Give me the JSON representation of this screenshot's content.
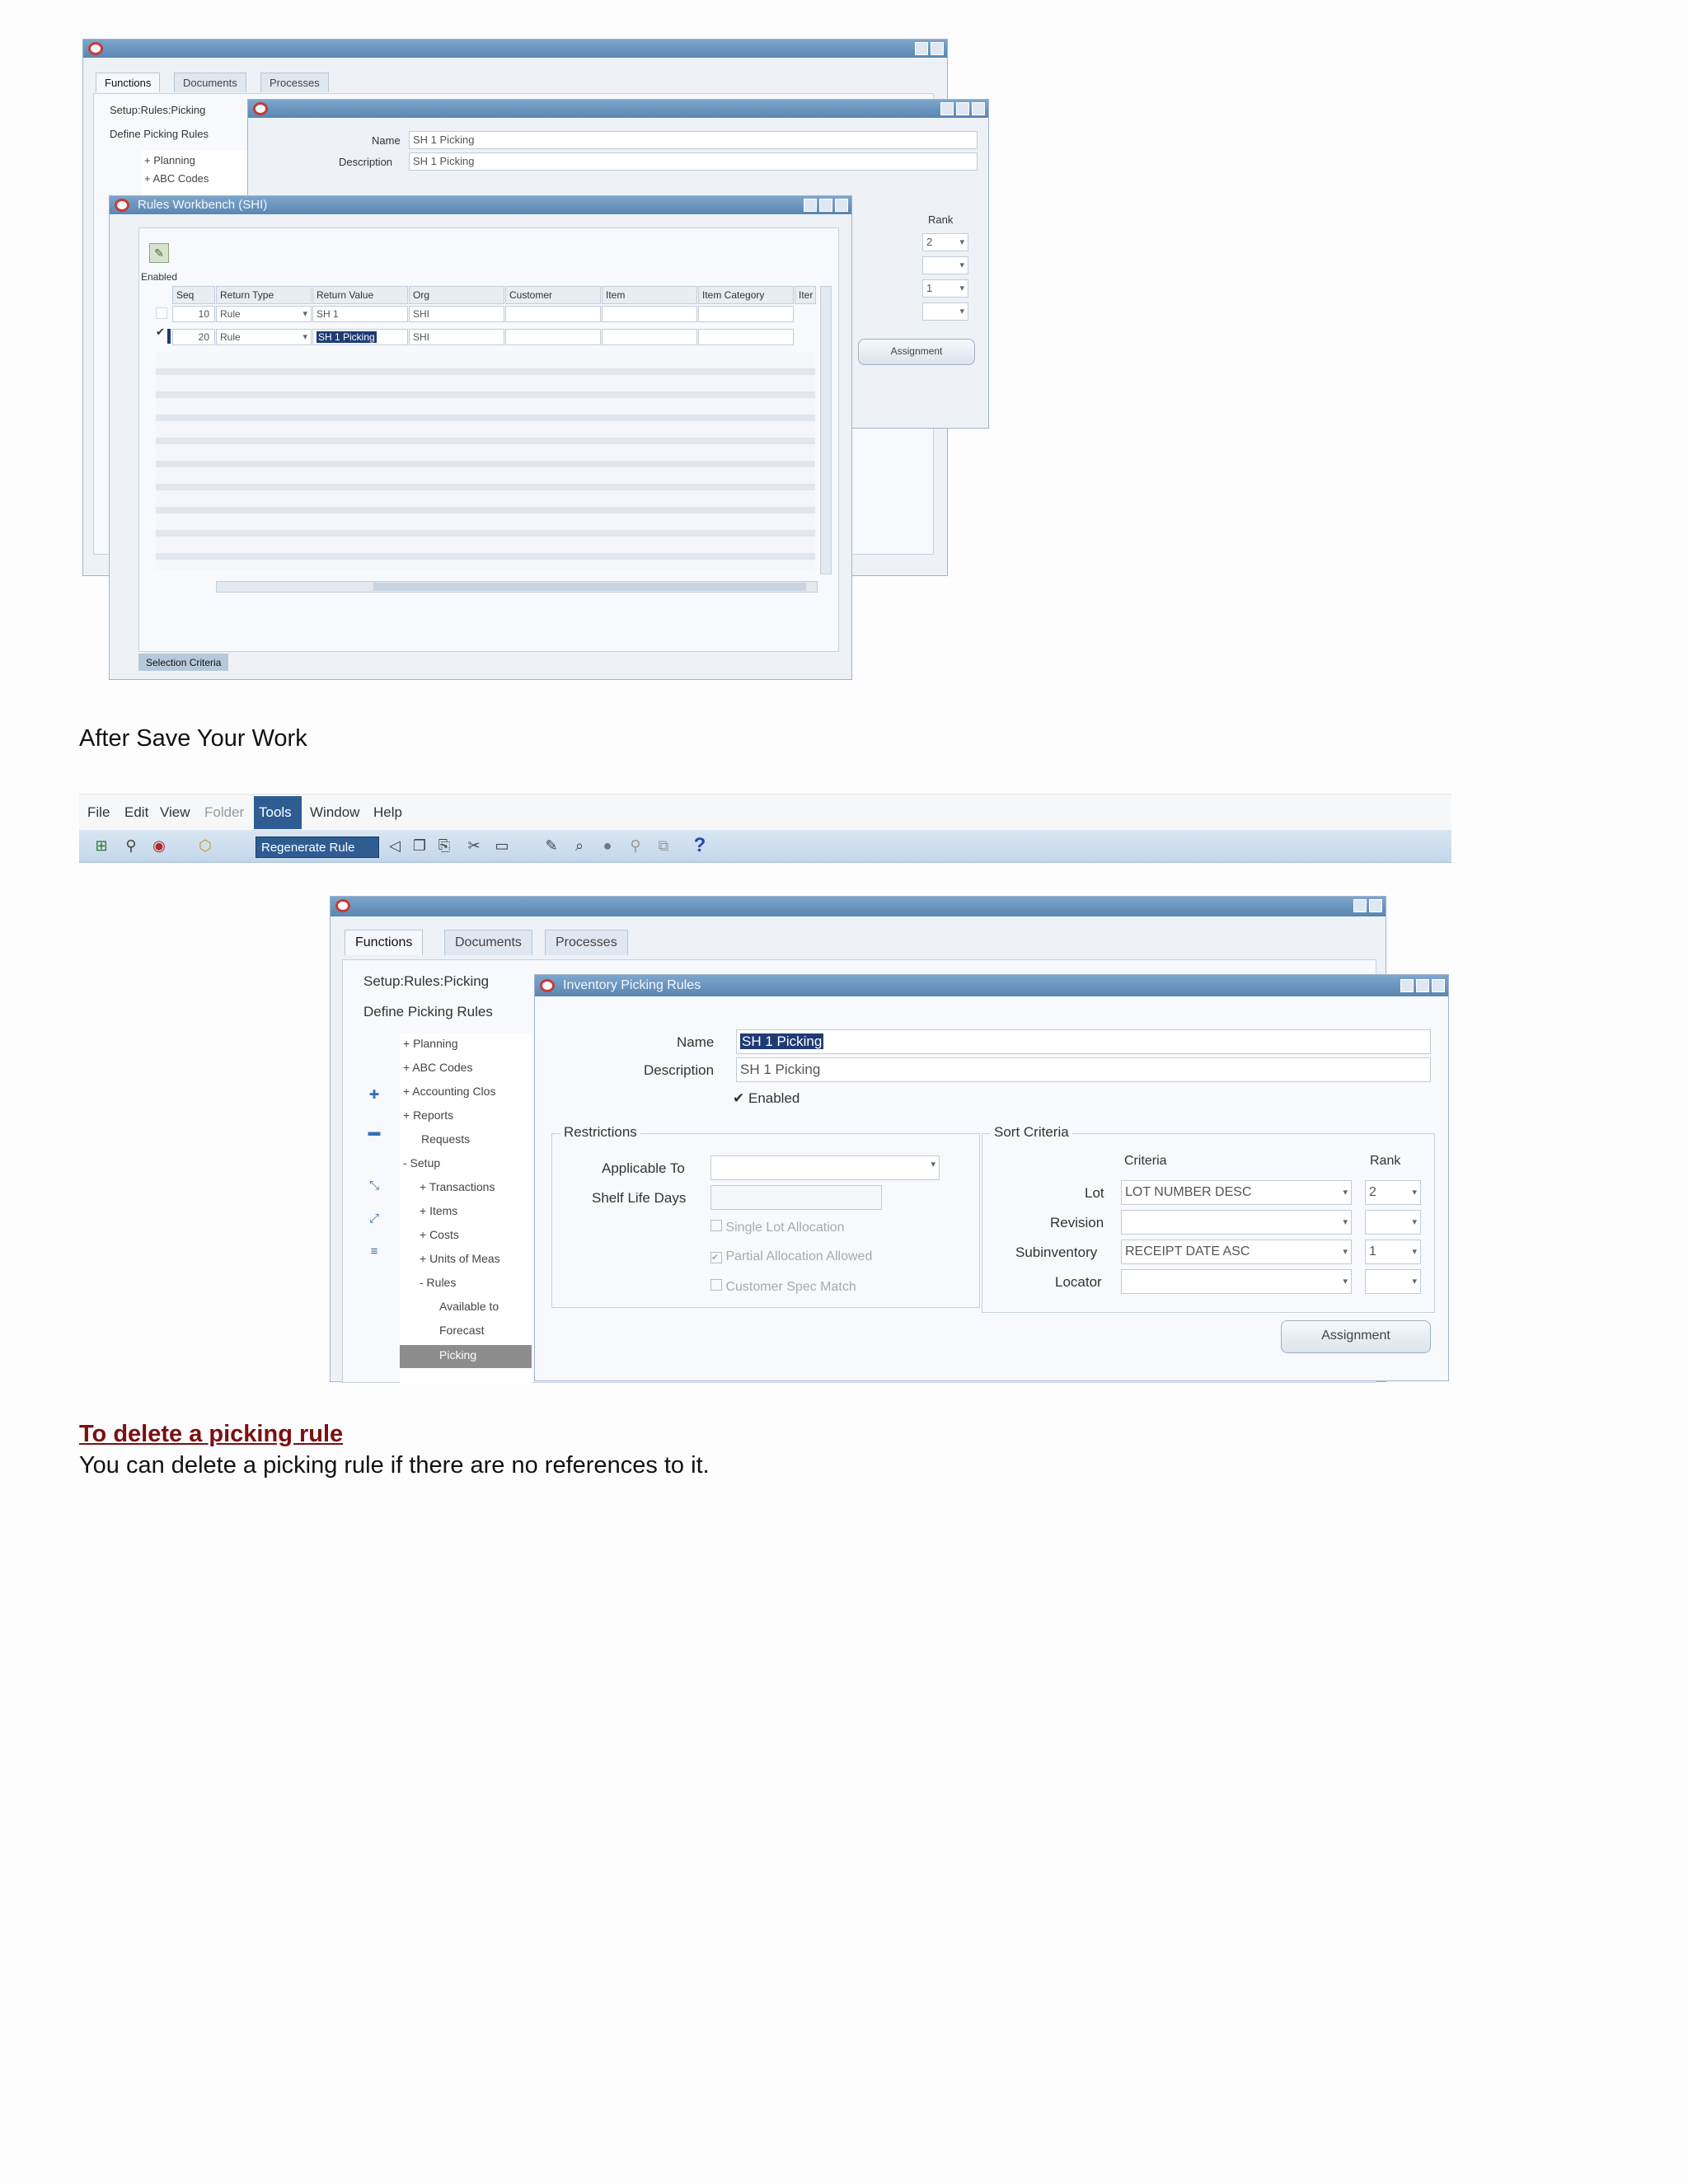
{
  "fig1": {
    "nav_tabs": [
      "Functions",
      "Documents",
      "Processes"
    ],
    "nav_labels": [
      "Setup:Rules:Picking",
      "Define Picking Rules"
    ],
    "tree": [
      "+ Planning",
      "+ ABC Codes"
    ],
    "picking_rules": {
      "name_label": "Name",
      "name_value": "SH 1 Picking",
      "desc_label": "Description",
      "desc_value": "SH 1 Picking",
      "rank_label": "Rank",
      "rank_values": [
        "2",
        "",
        "1",
        ""
      ],
      "assignment_label": "Assignment"
    },
    "workbench": {
      "title": "Rules Workbench (SHI)",
      "enabled_label": "Enabled",
      "columns": [
        "Seq",
        "Return Type",
        "Return Value",
        "Org",
        "Customer",
        "Item",
        "Item Category",
        "Iter"
      ],
      "rows": [
        {
          "enabled": "",
          "seq": "10",
          "return_type": "Rule",
          "return_value": "SH 1",
          "org": "SHI"
        },
        {
          "enabled": "✔",
          "seq": "20",
          "return_type": "Rule",
          "return_value": "SH 1 Picking",
          "org": "SHI"
        }
      ],
      "bottom_tab": "Selection Criteria"
    }
  },
  "caption": "After Save Your Work",
  "fig2": {
    "menu": [
      "File",
      "Edit",
      "View",
      "Folder",
      "Tools",
      "Window",
      "Help"
    ],
    "toolbar_tooltip": "Regenerate Rule",
    "help_glyph": "?",
    "nav_tabs": [
      "Functions",
      "Documents",
      "Processes"
    ],
    "nav_labels": [
      "Setup:Rules:Picking",
      "Define Picking Rules"
    ],
    "tree": [
      "+ Planning",
      "+ ABC Codes",
      "+ Accounting Clos",
      "+ Reports",
      "Requests",
      "- Setup",
      "+ Transactions",
      "+ Items",
      "+ Costs",
      "+ Units of Meas",
      "- Rules",
      "Available to",
      "Forecast",
      "Picking"
    ],
    "form": {
      "title": "Inventory Picking Rules",
      "name_label": "Name",
      "name_value": "SH 1 Picking",
      "desc_label": "Description",
      "desc_value": "SH 1 Picking",
      "enabled_label": "Enabled",
      "restrictions_title": "Restrictions",
      "applicable_to_label": "Applicable To",
      "shelf_life_label": "Shelf Life Days",
      "checks": [
        {
          "label": "Single Lot Allocation",
          "checked": ""
        },
        {
          "label": "Partial Allocation Allowed",
          "checked": "✔"
        },
        {
          "label": "Customer Spec Match",
          "checked": ""
        }
      ],
      "sort_title": "Sort Criteria",
      "criteria_header": "Criteria",
      "rank_header": "Rank",
      "sort_rows": [
        {
          "label": "Lot",
          "criteria": "LOT NUMBER DESC",
          "rank": "2"
        },
        {
          "label": "Revision",
          "criteria": "",
          "rank": ""
        },
        {
          "label": "Subinventory",
          "criteria": "RECEIPT DATE ASC",
          "rank": "1"
        },
        {
          "label": "Locator",
          "criteria": "",
          "rank": ""
        }
      ],
      "assignment_label": "Assignment"
    }
  },
  "heading": "To delete a picking rule",
  "body_text": "You can delete a picking rule if there are no references to it.",
  "colors": {
    "heading": "#7a1010",
    "title_bar": "#5a86b2",
    "highlight": "#1f3b74"
  }
}
